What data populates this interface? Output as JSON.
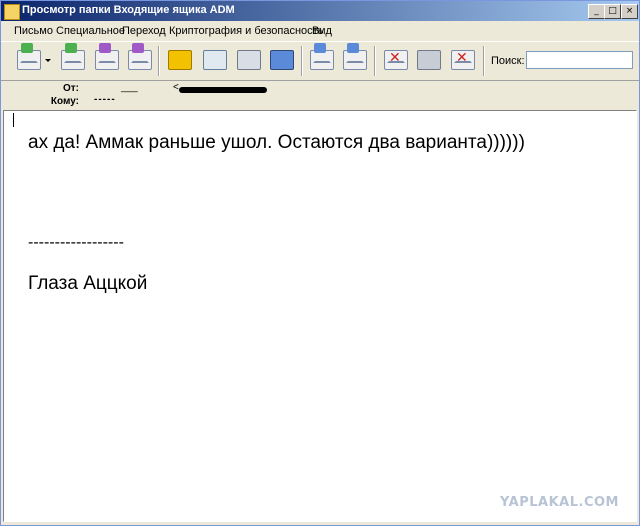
{
  "window": {
    "title": "Просмотр папки Входящие ящика ADM",
    "min_label": "_",
    "max_label": "□",
    "close_label": "×"
  },
  "menu": {
    "items": [
      "Письмо",
      "Специальное",
      "Переход",
      "Криптография и безопасность",
      "Вид"
    ]
  },
  "toolbar": {
    "buttons": [
      "reply-icon",
      "forward-icon",
      "move-icon",
      "copy-icon",
      "address-book-icon",
      "view-icon",
      "print-icon",
      "save-icon",
      "previous-icon",
      "next-icon",
      "delete-icon",
      "trash-icon",
      "purge-icon"
    ],
    "search_label": "Поиск:",
    "search_value": ""
  },
  "header": {
    "from_label": "От:",
    "from_value_left": "___",
    "from_value_right": "<",
    "to_label": "Кому:",
    "to_value": "-----"
  },
  "message": {
    "line1": "ах да! Аммак раньше ушол. Остаются два варианта))))))",
    "separator": "------------------",
    "signature": "Глаза Аццкой"
  },
  "watermark": "YAPLAKAL.COM",
  "colors": {
    "title_bar": "#0a246a",
    "window_bg": "#ece9d8",
    "body_bg": "#ffffff"
  }
}
